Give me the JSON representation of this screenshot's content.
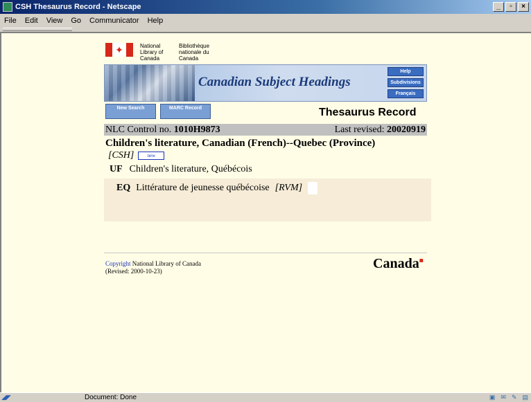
{
  "window": {
    "title": "CSH Thesaurus Record - Netscape",
    "controls": [
      "_",
      "▫",
      "×"
    ]
  },
  "menu": [
    "File",
    "Edit",
    "View",
    "Go",
    "Communicator",
    "Help"
  ],
  "status": {
    "text": "Document: Done"
  },
  "header": {
    "agency_en": "National Library of Canada",
    "agency_fr": "Bibliothèque nationale du Canada"
  },
  "banner": {
    "title": "Canadian Subject Headings",
    "links": [
      "Help",
      "Subdivisions",
      "Français"
    ]
  },
  "nav": {
    "new_search": "New Search",
    "marc_record": "MARC Record"
  },
  "record": {
    "section_title": "Thesaurus Record",
    "control_label": "NLC Control no.",
    "control_no": "1010H9873",
    "revised_label": "Last revised:",
    "revised_date": "20020919",
    "heading": "Children's literature, Canadian (French)--Quebec (Province)",
    "source": "[CSH]",
    "badge": "new",
    "uf_code": "UF",
    "uf_text": "Children's literature, Québécois",
    "eq_code": "EQ",
    "eq_text": "Littérature de jeunesse québécoise",
    "eq_source": "[RVM]"
  },
  "footer": {
    "copyright_link": "Copyright",
    "copyright_rest": "National Library of Canada",
    "revised": "(Revised: 2000-10-23)",
    "wordmark": "Canada"
  }
}
